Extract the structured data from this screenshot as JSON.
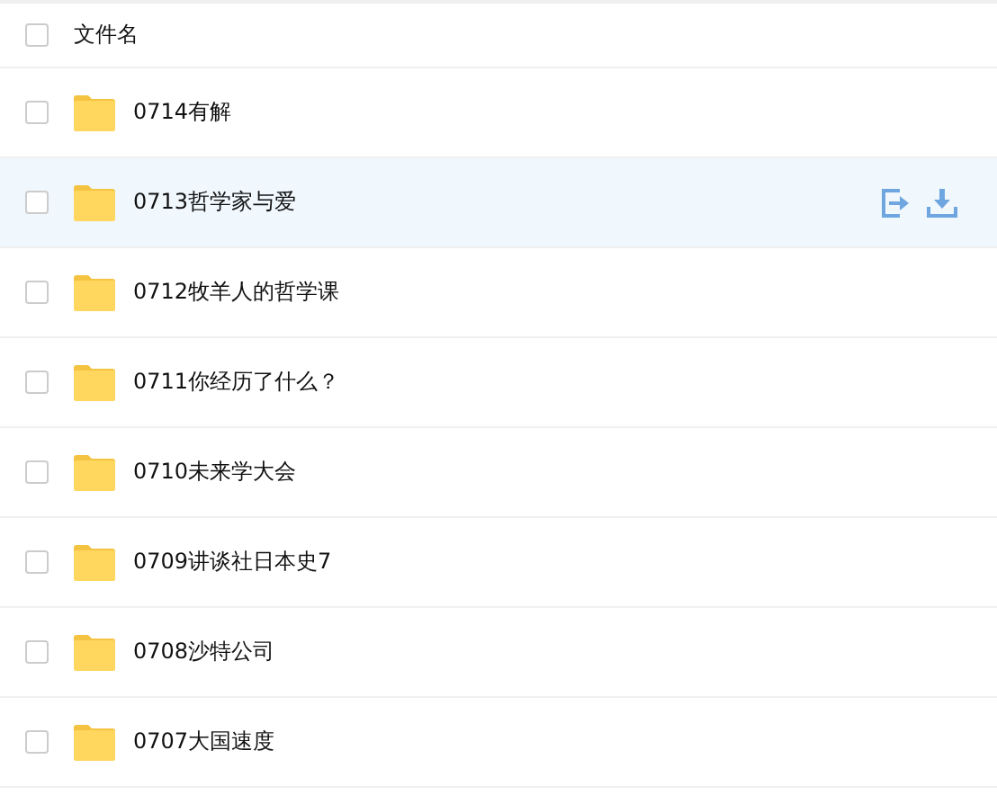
{
  "header": {
    "checked": false,
    "column_label": "文件名"
  },
  "files": [
    {
      "name": "0714有解",
      "checked": false,
      "highlighted": false
    },
    {
      "name": "0713哲学家与爱",
      "checked": false,
      "highlighted": true
    },
    {
      "name": "0712牧羊人的哲学课",
      "checked": false,
      "highlighted": false
    },
    {
      "name": "0711你经历了什么？",
      "checked": false,
      "highlighted": false
    },
    {
      "name": "0710未来学大会",
      "checked": false,
      "highlighted": false
    },
    {
      "name": "0709讲谈社日本史7",
      "checked": false,
      "highlighted": false
    },
    {
      "name": "0708沙特公司",
      "checked": false,
      "highlighted": false
    },
    {
      "name": "0707大国速度",
      "checked": false,
      "highlighted": false
    }
  ]
}
